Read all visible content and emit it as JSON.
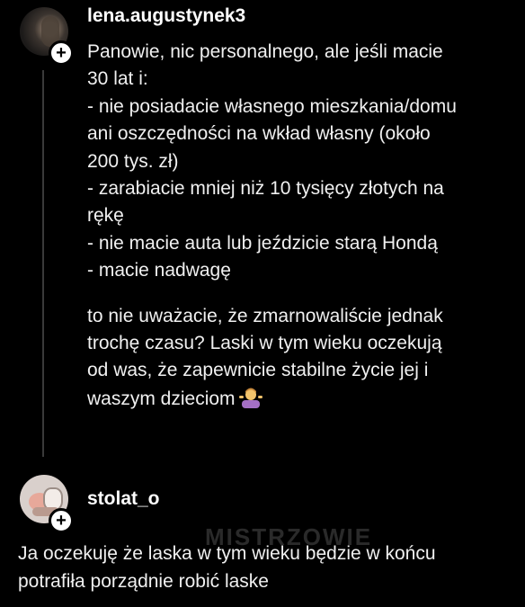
{
  "post": {
    "username": "lena.augustynek3",
    "lines": [
      "Panowie, nic personalnego, ale jeśli macie",
      "30 lat i:",
      "- nie posiadacie własnego mieszkania/domu",
      "ani oszczędności na wkład własny (około",
      "200 tys. zł)",
      "- zarabiacie mniej niż 10 tysięcy złotych na",
      "rękę",
      "- nie macie auta lub jeździcie starą Hondą",
      "- macie nadwagę"
    ],
    "lines2": [
      "to nie uważacie, że zmarnowaliście jednak",
      "trochę czasu? Laski w tym wieku oczekują",
      "od was, że zapewnicie stabilne życie jej i",
      "waszym dzieciom"
    ],
    "emoji": "person-shrugging-emoji"
  },
  "reply": {
    "username": "stolat_o",
    "lines": [
      "Ja oczekuję że laska w tym wieku będzie w końcu",
      "potrafiła porządnie robić laske"
    ]
  },
  "watermark": "MISTRZOWIE"
}
